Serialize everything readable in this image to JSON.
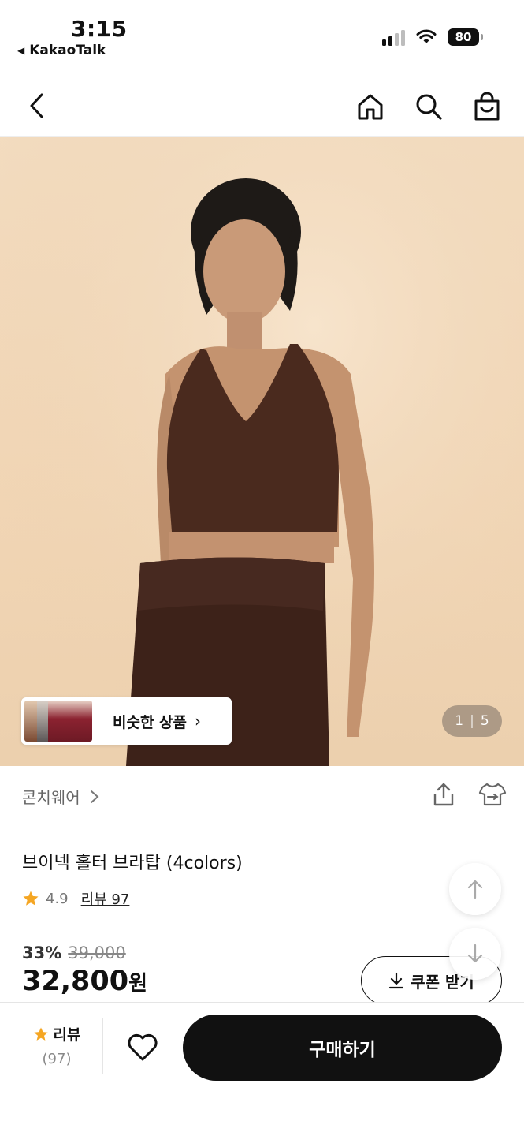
{
  "status_bar": {
    "time": "3:15",
    "back_app": "KakaoTalk",
    "battery": "80"
  },
  "nav": {
    "icons": [
      "back-icon",
      "home-icon",
      "search-icon",
      "shopping-bag-icon"
    ]
  },
  "gallery": {
    "similar_label": "비슷한 상품",
    "current": "1",
    "total": "5"
  },
  "brand": {
    "name": "콘치웨어",
    "actions": [
      "share-icon",
      "try-on-icon"
    ]
  },
  "product": {
    "title": "브이넥 홀터 브라탑 (4colors)",
    "rating": "4.9",
    "review_label": "리뷰 97",
    "discount": "33%",
    "original_price": "39,000",
    "price": "32,800",
    "currency": "원",
    "coupon_label": "쿠폰 받기"
  },
  "bottom_bar": {
    "review_label": "리뷰",
    "review_count": "(97)",
    "buy_label": "구매하기"
  },
  "colors": {
    "accent_star": "#F5A623",
    "buy_button": "#111111",
    "hero_bg": "#F1D5B4",
    "garment": "#4A2A1E"
  }
}
